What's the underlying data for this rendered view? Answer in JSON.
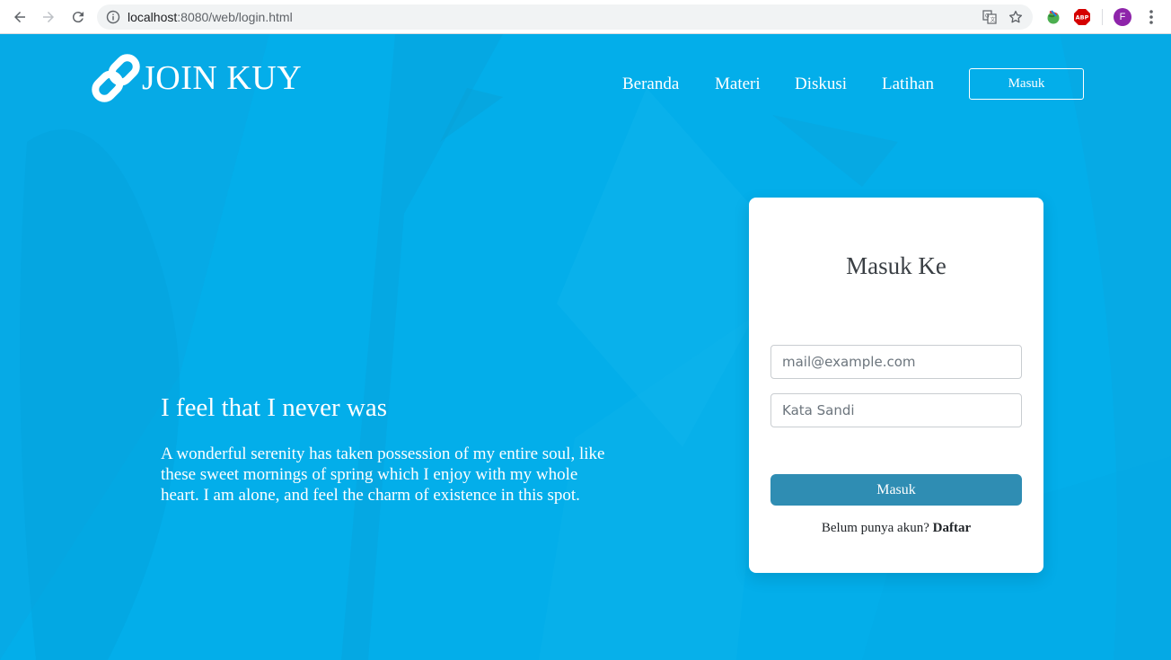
{
  "browser": {
    "url_host": "localhost",
    "url_rest": ":8080/web/login.html",
    "profile_initial": "F"
  },
  "brand": {
    "name": "JOIN KUY",
    "logo_icon": "chain-link-icon",
    "bg_color": "#03aeea"
  },
  "nav": {
    "items": [
      "Beranda",
      "Materi",
      "Diskusi",
      "Latihan"
    ],
    "login_label": "Masuk"
  },
  "hero": {
    "title": "I feel that I never was",
    "text": "A wonderful serenity has taken possession of my entire soul, like these sweet mornings of spring which I enjoy with my whole heart. I am alone, and feel the charm of existence in this spot."
  },
  "login_card": {
    "title": "Masuk Ke",
    "email_placeholder": "mail@example.com",
    "password_placeholder": "Kata Sandi",
    "submit_label": "Masuk",
    "signup_prompt": "Belum punya akun?",
    "signup_link": "Daftar",
    "button_color": "#2f8db3"
  }
}
